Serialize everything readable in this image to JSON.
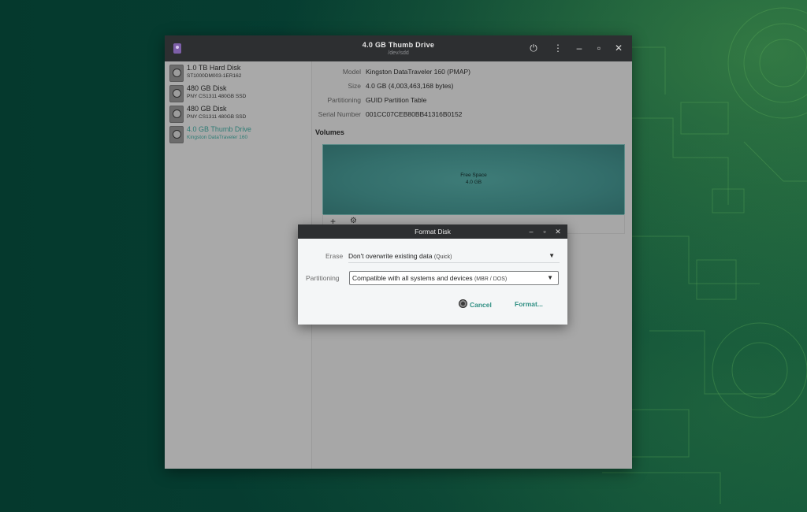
{
  "window": {
    "title": "4.0 GB Thumb Drive",
    "subtitle": "/dev/sdd"
  },
  "titlebar_icons": {
    "power": "power-icon",
    "menu": "kebab-menu-icon",
    "minimize": "minimize-icon",
    "maximize": "maximize-icon",
    "close": "close-icon"
  },
  "sidebar": {
    "disks": [
      {
        "name": "1.0 TB Hard Disk",
        "sub": "ST1000DM003-1ER162"
      },
      {
        "name": "480 GB Disk",
        "sub": "PNY CS1311 480GB SSD"
      },
      {
        "name": "480 GB Disk",
        "sub": "PNY CS1311 480GB SSD"
      },
      {
        "name": "4.0 GB Thumb Drive",
        "sub": "Kingston DataTraveler 160",
        "selected": true
      }
    ]
  },
  "details": {
    "model_label": "Model",
    "model_value": "Kingston DataTraveler 160 (PMAP)",
    "size_label": "Size",
    "size_value": "4.0 GB (4,003,463,168 bytes)",
    "partitioning_label": "Partitioning",
    "partitioning_value": "GUID Partition Table",
    "serial_label": "Serial Number",
    "serial_value": "001CC07CEB80BB41316B0152"
  },
  "volumes": {
    "heading": "Volumes",
    "segment_label": "Free Space",
    "segment_size": "4.0 GB",
    "add_tool": "+",
    "settings_tool": "⚙"
  },
  "dialog": {
    "title": "Format Disk",
    "erase_label": "Erase",
    "erase_value": "Don't overwrite existing data",
    "erase_hint": "(Quick)",
    "partitioning_label": "Partitioning",
    "partitioning_value": "Compatible with all systems and devices",
    "partitioning_hint": "(MBR / DOS)",
    "cancel_label": "Cancel",
    "format_label": "Format..."
  },
  "colors": {
    "accent": "#2f8f83",
    "titlebar": "#2d2f31",
    "volume": "#336e6b"
  }
}
